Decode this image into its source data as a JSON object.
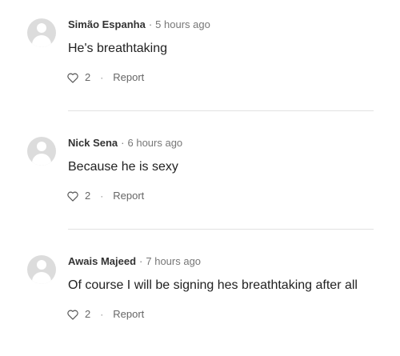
{
  "comments": [
    {
      "author": "Simão Espanha",
      "separator": "·",
      "time": "5 hours ago",
      "text": "He's breathtaking",
      "likes": "2",
      "action_dot": "·",
      "report_label": "Report"
    },
    {
      "author": "Nick Sena",
      "separator": "·",
      "time": "6 hours ago",
      "text": "Because he is sexy",
      "likes": "2",
      "action_dot": "·",
      "report_label": "Report"
    },
    {
      "author": "Awais Majeed",
      "separator": "·",
      "time": "7 hours ago",
      "text": "Of course I will be signing hes breathtaking after all",
      "likes": "2",
      "action_dot": "·",
      "report_label": "Report"
    }
  ],
  "colors": {
    "avatar_bg": "#dcdcdc",
    "divider": "#e2e2e2",
    "meta_text": "#777777"
  }
}
